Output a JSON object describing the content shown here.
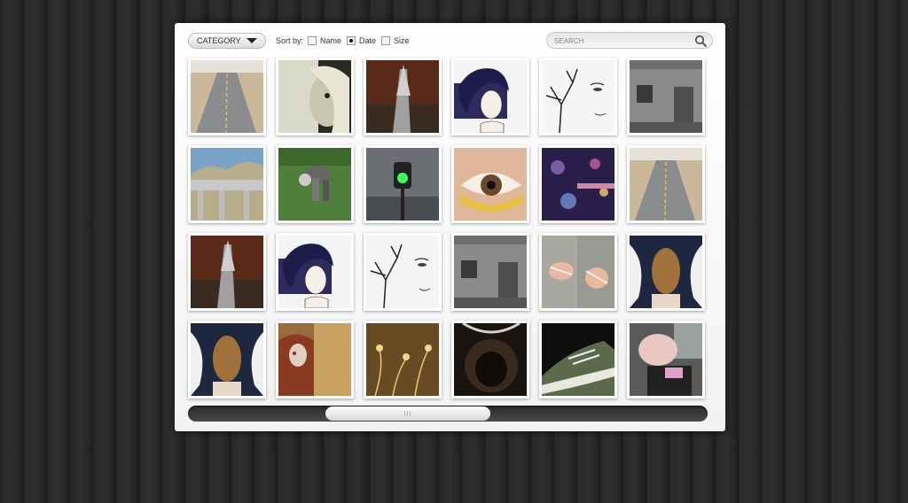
{
  "toolbar": {
    "category_label": "CATEGORY",
    "sort_by_label": "Sort by:",
    "sort_options": [
      {
        "label": "Name",
        "checked": false
      },
      {
        "label": "Date",
        "checked": true
      },
      {
        "label": "Size",
        "checked": false
      }
    ],
    "search_placeholder": "SEARCH"
  },
  "gallery": {
    "thumbnails": [
      {
        "subject": "desert road"
      },
      {
        "subject": "pale woman portrait"
      },
      {
        "subject": "rusty spike"
      },
      {
        "subject": "woman with swirling hair illustration"
      },
      {
        "subject": "tree and face sketch"
      },
      {
        "subject": "ruined wall"
      },
      {
        "subject": "bridge on hillside"
      },
      {
        "subject": "man bending on grass"
      },
      {
        "subject": "green traffic light"
      },
      {
        "subject": "eye close-up"
      },
      {
        "subject": "city bokeh at night"
      },
      {
        "subject": "desert road"
      },
      {
        "subject": "rusty spike"
      },
      {
        "subject": "woman with swirling hair illustration"
      },
      {
        "subject": "tree and face sketch"
      },
      {
        "subject": "ruined wall"
      },
      {
        "subject": "ripped jeans"
      },
      {
        "subject": "angel with curly hair"
      },
      {
        "subject": "angel with curly hair"
      },
      {
        "subject": "woman against brick wall"
      },
      {
        "subject": "floral pattern"
      },
      {
        "subject": "dark hood"
      },
      {
        "subject": "sneaker"
      },
      {
        "subject": "person in car"
      }
    ]
  },
  "scrollbar": {
    "position": 0.27,
    "visible_fraction": 0.32
  },
  "colors": {
    "background": "#262626",
    "panel": "#ffffff",
    "scroll_track": "#333333"
  }
}
